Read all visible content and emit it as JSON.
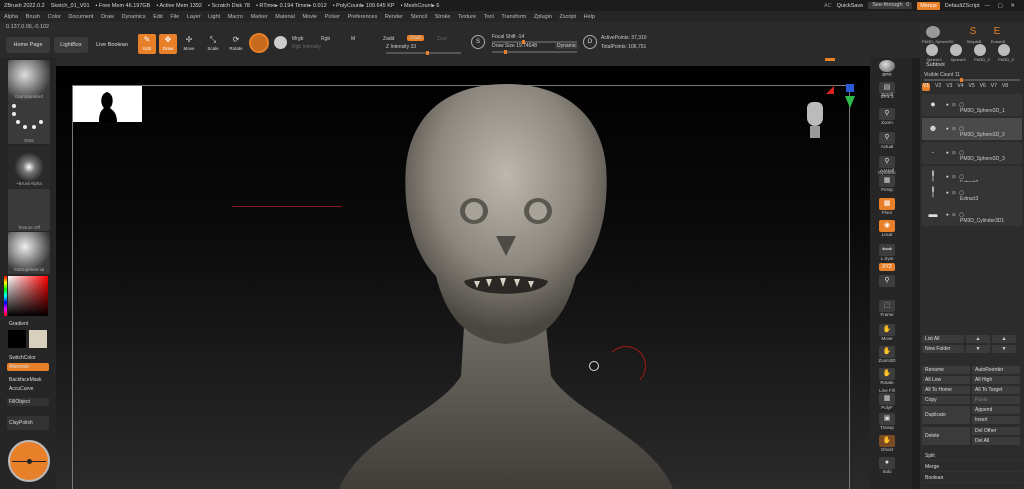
{
  "titlebar": {
    "app": "ZBrush 2022.0.2",
    "doc": "Sketch_01_V01",
    "free_mem": "• Free Mem 46.197GB",
    "active_mem": "• Active Mem 1392",
    "scratch": "• Scratch Disk 78",
    "rtime": "• RTime▸ 0.194 Timer▸ 0.012",
    "polycount": "• PolyCount▸ 109.645 KP",
    "meshcount": "• MeshCount▸ 6",
    "ac": "AC",
    "quicksave": "QuickSave",
    "seethrough": "See-through",
    "seethrough_value": "0",
    "menus": "Menus",
    "defaultzscript": "DefaultZScript"
  },
  "menubar": [
    "Alpha",
    "Brush",
    "Color",
    "Document",
    "Draw",
    "Dynamics",
    "Edit",
    "File",
    "Layer",
    "Light",
    "Macro",
    "Marker",
    "Material",
    "Movie",
    "Picker",
    "Preferences",
    "Render",
    "Stencil",
    "Stroke",
    "Texture",
    "Tool",
    "Transform",
    "Zplugin",
    "Zscript",
    "Help"
  ],
  "coords": "0.137,0.06,-0.102",
  "toolbar": {
    "home": "Home Page",
    "lightbox": "LightBox",
    "liveboolean": "Live Boolean",
    "edit": "Edit",
    "draw": "Draw",
    "move": "Move",
    "scale": "Scale",
    "rotate": "Rotate",
    "mrgb": "Mrgb",
    "rgb": "Rgb",
    "m": "M",
    "rgb_intensity": "Rgb Intensity",
    "zadd": "Zadd",
    "zsub": "Zsub",
    "zcut": "Zcut",
    "z_intensity": "Z Intensity 33",
    "focal_shift": "Focal Shift -14",
    "draw_size": "Draw Size 19.74648",
    "dynamic": "Dynamic",
    "active_points": "ActivePoints: 37,310",
    "total_points": "TotalPoints: 106,751"
  },
  "leftpanel": {
    "brush": "DamStandard",
    "stroke": "Dots",
    "alpha": "~BrushAlpha",
    "texture": "Texture Off",
    "material": "StartupMaterial",
    "gradient": "Gradient",
    "switchcolor": "SwitchColor",
    "alternate": "Alternate",
    "backfacemask": "BackfaceMask",
    "accucurve": "AccuCurve",
    "fillobject": "FillObject",
    "claypolish": "ClayPolish"
  },
  "rightstrip": {
    "bpr": "BPR",
    "spix": "SPix 3",
    "scroll": "Scroll",
    "zoom": "Zoom",
    "actual": "Actual",
    "aahalf": "AAHalf",
    "dynamic": "Dynamic",
    "persp": "Persp",
    "floor": "Floor",
    "local": "Local",
    "lsym": "L.Sym",
    "xyz": "XYZ",
    "frame": "Frame",
    "move": "Move",
    "zoom3d": "Zoom3D",
    "rotate": "Rotate",
    "lineFill": "Line Fill",
    "polyf": "PolyF",
    "transp": "Transp",
    "ghost": "Ghost",
    "solo": "Solo"
  },
  "subtool": {
    "thumbs": [
      "PM3D_Sphere3D",
      "SimpleB",
      "EraserB",
      "Sphere3",
      "Sphere3",
      "PM3D_S",
      "PM3D_S"
    ],
    "title": "Subtool",
    "visible_count": "Visible Count 11",
    "tabs": [
      "V1",
      "V2",
      "V3",
      "V4",
      "V5",
      "V6",
      "V7",
      "V8"
    ],
    "items": [
      "PM3D_Sphere3D_1",
      "PM3D_Sphere3D_2",
      "PM3D_Sphere3D_3",
      "Extract2",
      "Extract3",
      "PM3D_Cylinder3D1"
    ],
    "list_all": "List All",
    "new_folder": "New Folder",
    "rename": "Rename",
    "autoreorder": "AutoReorder",
    "all_low": "All Low",
    "all_high": "All High",
    "all_to_home": "All To Home",
    "all_to_target": "All To Target",
    "copy": "Copy",
    "paste": "Paste",
    "duplicate": "Duplicate",
    "append": "Append",
    "insert": "Insert",
    "delete": "Delete",
    "del_other": "Del Other",
    "del_all": "Del All",
    "split": "Split",
    "merge": "Merge",
    "boolean": "Boolean"
  },
  "colors": {
    "accent": "#e8802a"
  }
}
